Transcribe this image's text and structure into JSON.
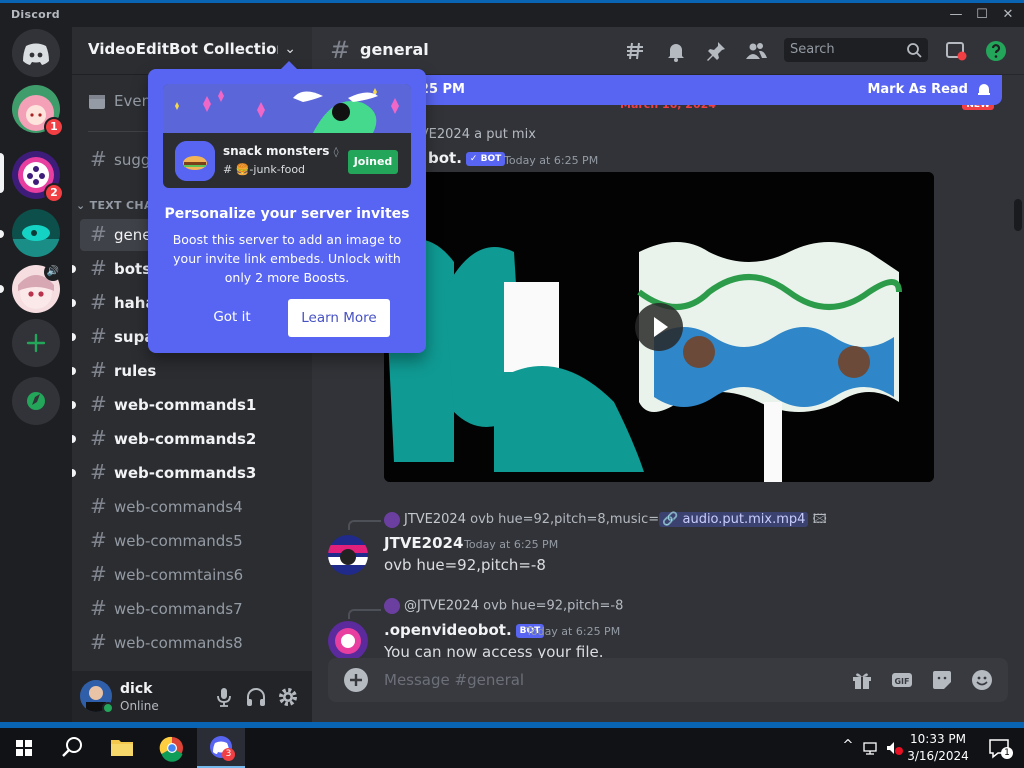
{
  "window": {
    "app_name": "Discord",
    "minimize": "—",
    "maximize": "☐",
    "close": "✕"
  },
  "servers": [
    {
      "name": "server-anime-avatar",
      "badge": "1"
    },
    {
      "name": "server-video-edit-bot",
      "badge": "2",
      "active": true
    },
    {
      "name": "server-teal-dots"
    },
    {
      "name": "server-anime-girl"
    }
  ],
  "guild": {
    "name": "VideoEditBot Collection ...",
    "events_label": "Even"
  },
  "sidebar": {
    "category": "TEXT CHA",
    "channels": [
      {
        "name": "sugg",
        "unread": false
      },
      {
        "name": "gene",
        "unread": false,
        "active": true
      },
      {
        "name": "bots",
        "unread": true
      },
      {
        "name": "haha",
        "unread": true
      },
      {
        "name": "supa",
        "unread": true
      },
      {
        "name": "rules",
        "unread": true
      },
      {
        "name": "web-commands1",
        "unread": true
      },
      {
        "name": "web-commands2",
        "unread": true
      },
      {
        "name": "web-commands3",
        "unread": true
      },
      {
        "name": "web-commands4",
        "unread": false
      },
      {
        "name": "web-commands5",
        "unread": false
      },
      {
        "name": "web-commtains6",
        "unread": false
      },
      {
        "name": "web-commands7",
        "unread": false
      },
      {
        "name": "web-commands8",
        "unread": false
      }
    ]
  },
  "user": {
    "name": "dick",
    "status": "Online"
  },
  "channel": {
    "name": "general",
    "search_placeholder": "Search"
  },
  "new_messages": {
    "text": "ages since 6:25 PM",
    "mark_read": "Mark As Read",
    "date_divider": "March 16, 2024",
    "new_tag": "NEW"
  },
  "messages": {
    "m1_reply_author": "JTVE2024",
    "m1_reply_text": "a put mix",
    "m1_author": "bot.",
    "m1_badge": "✓ BOT",
    "m1_time": "Today at 6:25 PM",
    "m2_reply_author": "JTVE2024",
    "m2_reply_text": "ovb hue=92,pitch=8,music=",
    "m2_reply_link": "audio.put.mix.mp4",
    "m2_author": "JTVE2024",
    "m2_time": "Today at 6:25 PM",
    "m2_text": "ovb hue=92,pitch=-8",
    "m3_reply_author": "@JTVE2024",
    "m3_reply_text": "ovb hue=92,pitch=-8",
    "m3_author": ".openvideobot.",
    "m3_badge": "BOT",
    "m3_time": "Today at 6:25 PM",
    "m3_text": "You can now access your file."
  },
  "composer": {
    "placeholder": "Message #general"
  },
  "popup": {
    "server_name": "snack monsters",
    "server_channel": "🍔-junk-food",
    "joined_label": "Joined",
    "title": "Personalize your server invites",
    "body": "Boost this server to add an image to your invite link embeds. Unlock with only 2 more Boosts.",
    "got_it": "Got it",
    "learn_more": "Learn More"
  },
  "taskbar": {
    "time": "10:33 PM",
    "date": "3/16/2024",
    "discord_badge": "3",
    "notif_count": "1"
  },
  "colors": {
    "blurple": "#5865f2",
    "green": "#23a55a",
    "red": "#f23f43",
    "teal": "#0f9a93"
  }
}
